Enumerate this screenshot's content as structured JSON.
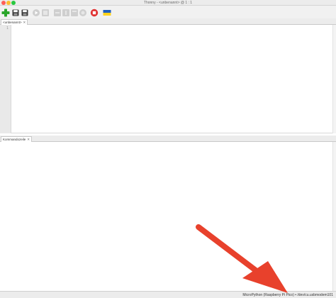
{
  "window": {
    "title": "Thonny - <unbenannt> @ 1 : 1"
  },
  "toolbar": {
    "buttons": [
      {
        "name": "new-file",
        "icon": "plus-icon",
        "color": "#2aa52a"
      },
      {
        "name": "open-file",
        "icon": "open-icon"
      },
      {
        "name": "save-file",
        "icon": "floppy-icon"
      },
      {
        "name": "run",
        "icon": "play-icon"
      },
      {
        "name": "debug",
        "icon": "debug-icon"
      },
      {
        "name": "step-over",
        "icon": "step-over-icon"
      },
      {
        "name": "step-into",
        "icon": "step-into-icon"
      },
      {
        "name": "step-out",
        "icon": "step-out-icon"
      },
      {
        "name": "resume",
        "icon": "resume-icon"
      },
      {
        "name": "stop",
        "icon": "stop-icon",
        "color": "#e03131"
      },
      {
        "name": "support-ukraine",
        "icon": "flag-icon",
        "colors": [
          "#1f5fbf",
          "#ffd21e"
        ]
      }
    ]
  },
  "editor": {
    "tab_label": "<unbenannt>",
    "tab_close": "✕",
    "line_numbers": [
      "1"
    ]
  },
  "shell": {
    "tab_label": "Kommandozeile",
    "tab_close": "✕"
  },
  "statusbar": {
    "interpreter_text": "MicroPython (Raspberry Pi Pico)  •  /dev/cu.usbmodem101"
  },
  "annotation": {
    "arrow_color": "#e8412c"
  }
}
